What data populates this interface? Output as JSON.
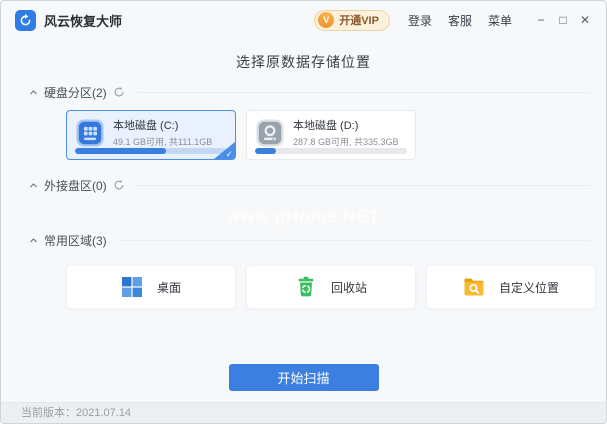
{
  "titlebar": {
    "app_title": "风云恢复大师",
    "vip_button": "开通VIP",
    "vip_badge": "V",
    "login": "登录",
    "support": "客服",
    "menu": "菜单",
    "minimize": "−",
    "maximize": "□",
    "close": "✕"
  },
  "heading": "选择原数据存储位置",
  "sections": {
    "disk_partitions": "硬盘分区(2)",
    "external_disks": "外接盘区(0)",
    "common_areas": "常用区域(3)"
  },
  "disks": [
    {
      "name": "本地磁盘 (C:)",
      "capacity": "49.1 GB可用, 共111.1GB",
      "used_percent": 60,
      "selected": true
    },
    {
      "name": "本地磁盘 (D:)",
      "capacity": "287.8 GB可用, 共335.3GB",
      "used_percent": 14,
      "selected": false
    }
  ],
  "common_areas": [
    {
      "label": "桌面",
      "icon": "windows-logo-icon"
    },
    {
      "label": "回收站",
      "icon": "recycle-bin-icon"
    },
    {
      "label": "自定义位置",
      "icon": "folder-search-icon"
    }
  ],
  "watermark": "www.pHome.NET",
  "scan_button": "开始扫描",
  "statusbar": {
    "version_label": "当前版本：2021.07.14"
  },
  "colors": {
    "primary_blue": "#3b7fe1",
    "selected_card_bg": "#e8f1fd",
    "selected_card_border": "#4a8ee8",
    "vip_pill_bg": "#fbf1dd",
    "vip_accent": "#f09c36",
    "recycle_green": "#3cbf63",
    "folder_yellow": "#f6b62e",
    "check_mark": "✓"
  }
}
